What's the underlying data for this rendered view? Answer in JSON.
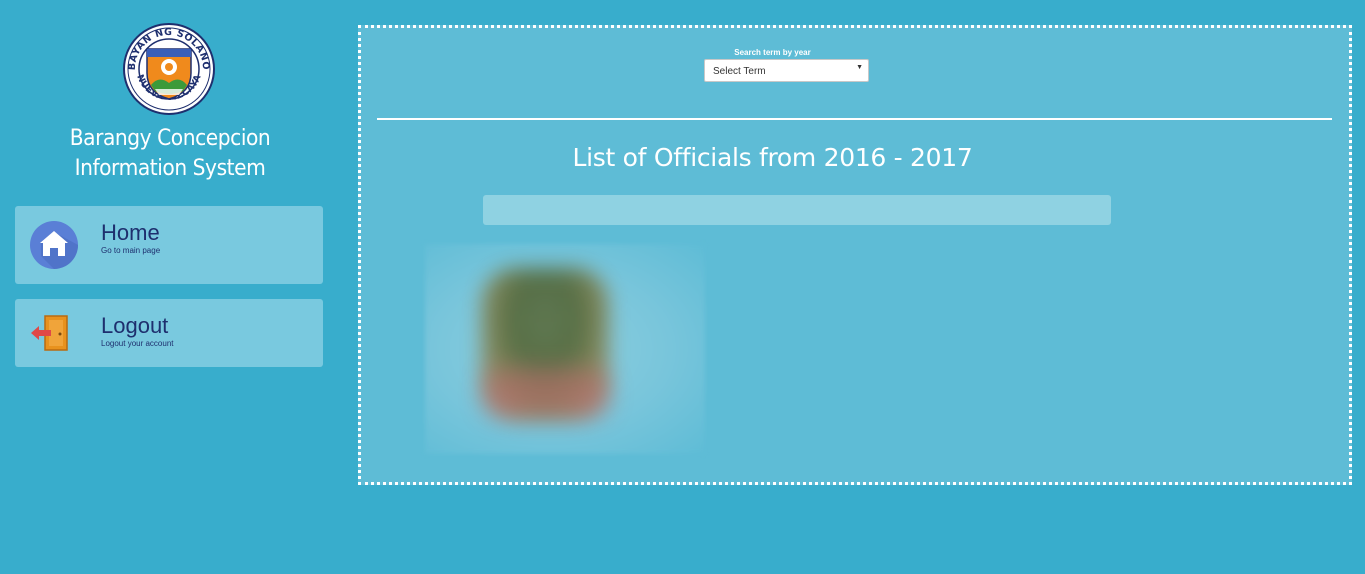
{
  "sidebar": {
    "logo_top_text": "BAYAN NG SOLANO",
    "logo_bottom_text": "NUEVA VIZCAYA",
    "app_title_line1": "Barangy Concepcion",
    "app_title_line2": "Information System",
    "items": [
      {
        "label": "Home",
        "sublabel": "Go to main page",
        "icon": "home-icon"
      },
      {
        "label": "Logout",
        "sublabel": "Logout your account",
        "icon": "logout-door-icon"
      }
    ]
  },
  "main": {
    "search_label": "Search term by year",
    "term_select": {
      "value": "Select Term"
    },
    "list_title": "List of Officials from 2016 - 2017"
  },
  "colors": {
    "background": "#38adcc",
    "panel": "#5ebcd6",
    "nav_card": "#79c9df",
    "nav_text": "#1e2f6e",
    "home_icon_circle": "#5a7fd6",
    "logout_door": "#e8921e",
    "logout_arrow": "#e04848"
  }
}
